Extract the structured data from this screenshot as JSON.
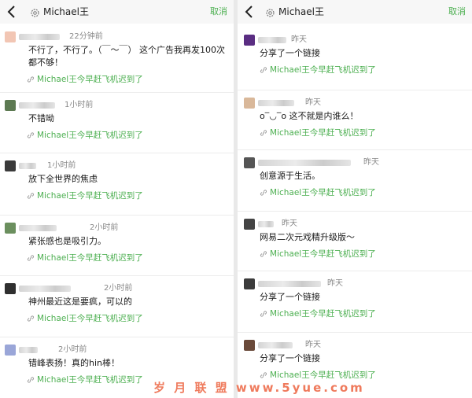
{
  "colors": {
    "accent": "#4caf50",
    "watermark": "#ef7a5c"
  },
  "left_panel": {
    "header": {
      "back_icon": "chevron-left-icon",
      "title_icon": "gear-icon",
      "title": "Michael王",
      "action": "取消"
    },
    "comments": [
      {
        "time": "22分钟前",
        "text_lines": [
          "不行了，不行了。（￣～￣） 这个广告我再发100次",
          "都不够！"
        ],
        "link": "Michael王今早赶飞机迟到了"
      },
      {
        "time": "1小时前",
        "text_lines": [
          "不错呦"
        ],
        "link": "Michael王今早赶飞机迟到了"
      },
      {
        "time": "1小时前",
        "text_lines": [
          "放下全世界的焦虑"
        ],
        "link": "Michael王今早赶飞机迟到了"
      },
      {
        "time": "2小时前",
        "text_lines": [
          "紧张感也是吸引力。"
        ],
        "link": "Michael王今早赶飞机迟到了"
      },
      {
        "time": "2小时前",
        "text_lines": [
          "神州最近这是要疯，可以的"
        ],
        "link": "Michael王今早赶飞机迟到了"
      },
      {
        "time": "2小时前",
        "text_lines": [
          "错峰表扬！真的hin棒！"
        ],
        "link": "Michael王今早赶飞机迟到了"
      }
    ]
  },
  "right_panel": {
    "header": {
      "back_icon": "chevron-left-icon",
      "title_icon": "gear-icon",
      "title": "Michael王",
      "action": "取消"
    },
    "comments": [
      {
        "time": "昨天",
        "text_lines": [
          "分享了一个链接"
        ],
        "link": "Michael王今早赶飞机迟到了"
      },
      {
        "time": "昨天",
        "text_lines": [
          "ο‾◡‾ο 这不就是内谁么！"
        ],
        "link": "Michael王今早赶飞机迟到了"
      },
      {
        "time": "昨天",
        "text_lines": [
          "创意源于生活。"
        ],
        "link": "Michael王今早赶飞机迟到了"
      },
      {
        "time": "昨天",
        "text_lines": [
          "网易二次元戏精升级版～"
        ],
        "link": "Michael王今早赶飞机迟到了"
      },
      {
        "time": "昨天",
        "text_lines": [
          "分享了一个链接"
        ],
        "link": "Michael王今早赶飞机迟到了"
      },
      {
        "time": "昨天",
        "text_lines": [
          "分享了一个链接"
        ],
        "link": "Michael王今早赶飞机迟到了"
      }
    ]
  },
  "watermark": "岁 月 联 盟  www.5yue.com"
}
